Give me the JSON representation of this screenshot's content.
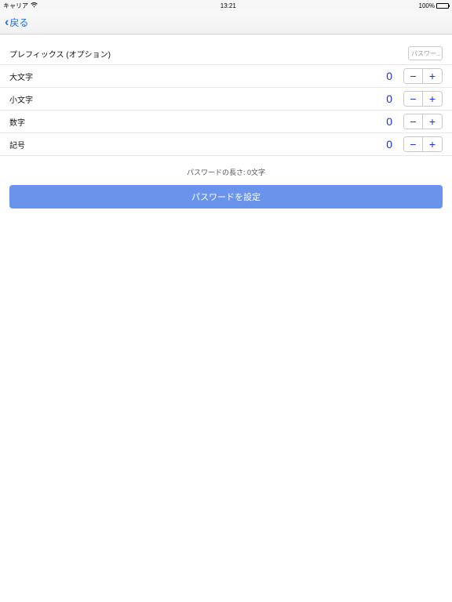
{
  "status": {
    "carrier": "キャリア",
    "time": "13:21",
    "battery": "100%"
  },
  "nav": {
    "back": "戻る"
  },
  "prefix": {
    "label": "プレフィックス (オプション)",
    "placeholder": "パスワー..."
  },
  "rows": {
    "upper": {
      "label": "大文字",
      "value": "0"
    },
    "lower": {
      "label": "小文字",
      "value": "0"
    },
    "digits": {
      "label": "数字",
      "value": "0"
    },
    "symbols": {
      "label": "記号",
      "value": "0"
    }
  },
  "length_text": "パスワードの長さ: 0文字",
  "set_button": "パスワードを設定"
}
